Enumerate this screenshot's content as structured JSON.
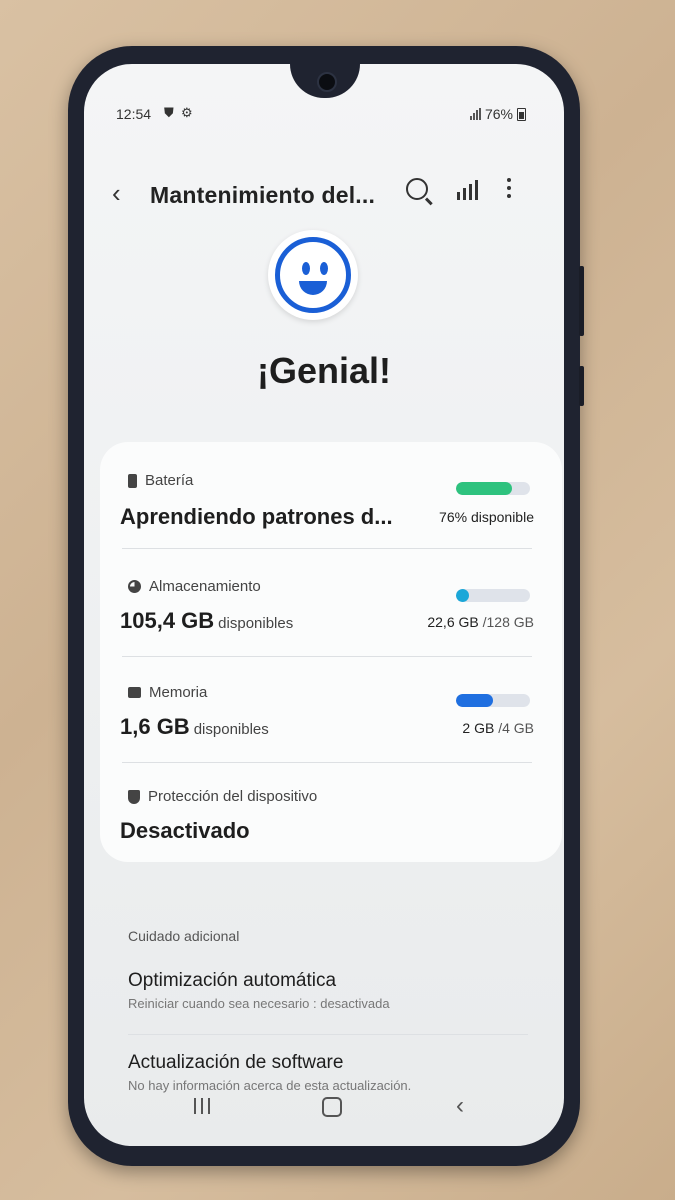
{
  "status_bar": {
    "time": "12:54",
    "battery_percent": "76%",
    "icons": [
      "shield-icon",
      "gear-icon",
      "signal-icon",
      "battery-icon"
    ]
  },
  "app_bar": {
    "title": "Mantenimiento del...",
    "actions": [
      "back-icon",
      "search-icon",
      "bar-chart-icon",
      "more-options-icon"
    ]
  },
  "summary": {
    "status": "¡Genial!",
    "icon": "smiley-icon",
    "accent": "#1a5fd6"
  },
  "cards": {
    "battery": {
      "label": "Batería",
      "value": "Aprendiendo patrones d...",
      "right": "76% disponible",
      "level": 0.76,
      "color": "#2ec27e"
    },
    "storage": {
      "label": "Almacenamiento",
      "value": "105,4 GB",
      "value_suffix": "disponibles",
      "used": "22,6 GB",
      "total": "/128 GB",
      "level": 0.18,
      "color": "#1ba7d8"
    },
    "memory": {
      "label": "Memoria",
      "value": "1,6 GB",
      "value_suffix": "disponibles",
      "used": "2 GB",
      "total": "/4 GB",
      "level": 0.5,
      "color": "#1f6fe0"
    },
    "protection": {
      "label": "Protección del dispositivo",
      "value": "Desactivado"
    }
  },
  "additional": {
    "header": "Cuidado adicional",
    "items": [
      {
        "title": "Optimización automática",
        "subtitle": "Reiniciar cuando sea necesario : desactivada"
      },
      {
        "title": "Actualización de software",
        "subtitle": "No hay información acerca de esta actualización."
      }
    ]
  },
  "nav_bar": {
    "buttons": [
      "recents-icon",
      "home-icon",
      "back-icon"
    ]
  }
}
